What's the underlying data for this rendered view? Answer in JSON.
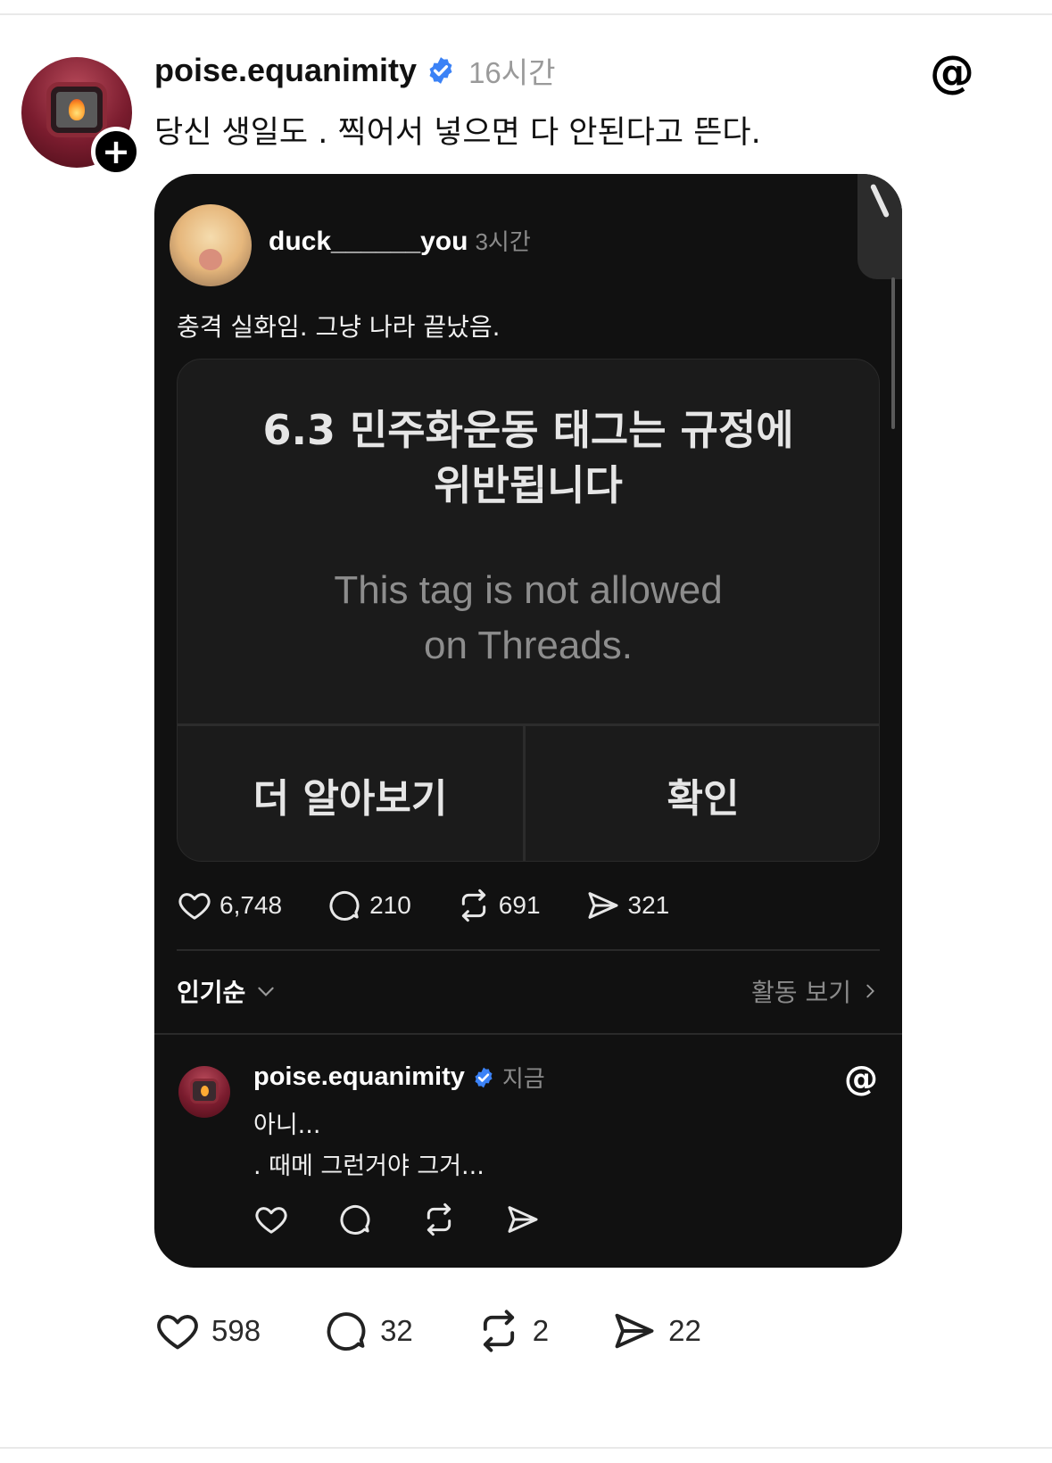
{
  "post": {
    "username": "poise.equanimity",
    "timestamp": "16시간",
    "text": "당신 생일도 . 찍어서 넣으면 다 안된다고 뜬다.",
    "follow_symbol": "+",
    "logo_glyph": "@",
    "stats": {
      "likes": "598",
      "replies": "32",
      "reposts": "2",
      "shares": "22"
    }
  },
  "embed": {
    "username": "duck______you",
    "timestamp": "3시간",
    "text": "충격 실화임. 그냥 나라 끝났음.",
    "dialog": {
      "title": "6.3 민주화운동 태그는 규정에\n위반됩니다",
      "subtitle": "This tag is not allowed\non Threads.",
      "left_button": "더 알아보기",
      "right_button": "확인"
    },
    "stats": {
      "likes": "6,748",
      "replies": "210",
      "reposts": "691",
      "shares": "321"
    },
    "sort_label": "인기순",
    "activity_label": "활동 보기",
    "reply": {
      "username": "poise.equanimity",
      "timestamp": "지금",
      "line1": "아니...",
      "line2": ". 때메 그런거야 그거...",
      "logo_glyph": "@"
    }
  },
  "colors": {
    "verified": "#3b82f6",
    "embed_bg": "#111111",
    "muted": "#9a9a9a"
  }
}
